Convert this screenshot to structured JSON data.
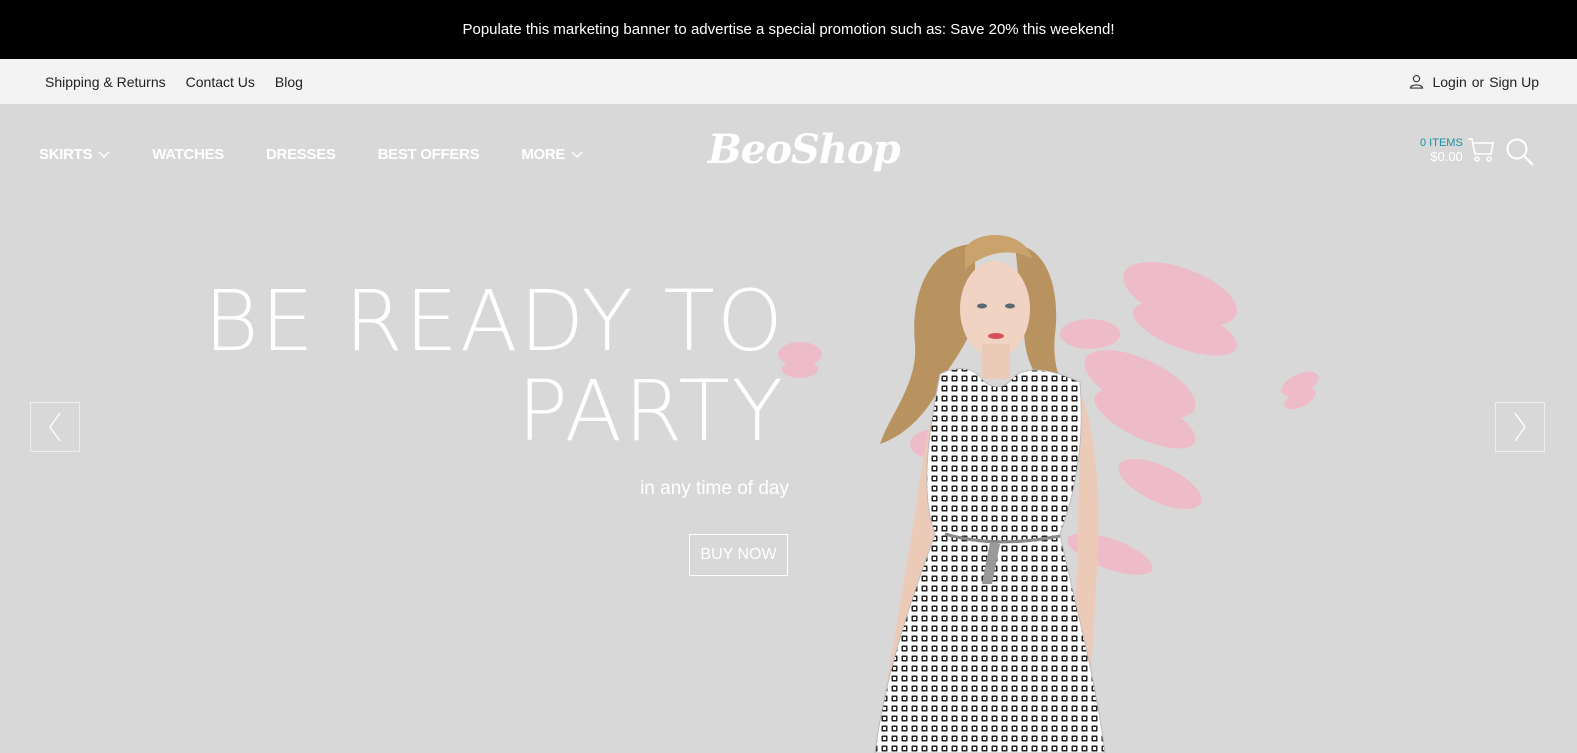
{
  "promo": {
    "text": "Populate this marketing banner to advertise a special promotion such as: Save 20% this weekend!"
  },
  "utility": {
    "links": [
      "Shipping & Returns",
      "Contact Us",
      "Blog"
    ],
    "login": "Login",
    "or": "or",
    "signup": "Sign Up"
  },
  "nav": {
    "items": [
      {
        "label": "SKIRTS",
        "icon": "chevron-down-icon"
      },
      {
        "label": "WATCHES"
      },
      {
        "label": "DRESSES"
      },
      {
        "label": "BEST OFFERS"
      },
      {
        "label": "MORE",
        "icon": "chevron-down-icon"
      }
    ]
  },
  "logo": {
    "text": "BeoShop"
  },
  "cart": {
    "count": "0 ITEMS",
    "total": "$0.00",
    "icon": "cart-icon"
  },
  "search": {
    "icon": "search-icon"
  },
  "hero": {
    "headline_line1": "BE READY TO",
    "headline_line2": "PARTY",
    "tagline": "in any time of day",
    "cta": "BUY NOW"
  },
  "colors": {
    "accent": "#1a8fa3",
    "promo_bg": "#000000",
    "hero_bg": "#d8d8d8",
    "lips": "#f2b8c6"
  }
}
